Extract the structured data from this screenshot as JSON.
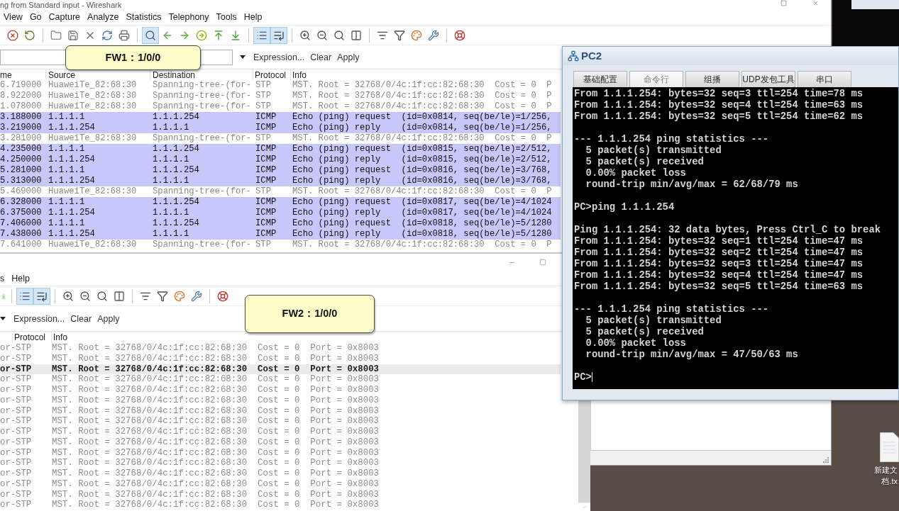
{
  "main_window": {
    "title": "ng from Standard input - Wireshark",
    "menu": [
      "View",
      "Go",
      "Capture",
      "Analyze",
      "Statistics",
      "Telephony",
      "Tools",
      "Help"
    ],
    "toolbar": [
      [
        {
          "pressed": false
        },
        {
          "pressed": false
        }
      ],
      [
        {
          "pressed": false
        },
        {
          "pressed": false
        },
        {
          "pressed": false
        },
        {
          "pressed": false
        },
        {
          "pressed": false
        }
      ],
      [
        {
          "pressed": true
        },
        {
          "pressed": false
        },
        {
          "pressed": false
        },
        {
          "pressed": false
        },
        {
          "pressed": false
        },
        {
          "pressed": false
        }
      ],
      [
        {
          "pressed": true
        },
        {
          "pressed": true
        }
      ],
      [
        {
          "pressed": false
        },
        {
          "pressed": false
        },
        {
          "pressed": false
        },
        {
          "pressed": false
        }
      ],
      [
        {
          "pressed": false
        },
        {
          "pressed": false
        },
        {
          "pressed": false
        },
        {
          "pressed": false
        }
      ],
      [
        {
          "pressed": false
        }
      ]
    ],
    "filter_buttons": [
      "Expression...",
      "Clear",
      "Apply"
    ],
    "packet_list": {
      "columns": [
        "me",
        "Source",
        "Destination",
        "Protocol",
        "Info"
      ],
      "rows": [
        {
          "kind": "stp",
          "time": "6.719000",
          "source": "HuaweiTe_82:68:30",
          "destination": "Spanning-tree-(for-",
          "protocol": "STP",
          "info": "MST. Root = 32768/0/4c:1f:cc:82:68:30  Cost = 0  P"
        },
        {
          "kind": "stp",
          "time": "8.922000",
          "source": "HuaweiTe_82:68:30",
          "destination": "Spanning-tree-(for-",
          "protocol": "STP",
          "info": "MST. Root = 32768/0/4c:1f:cc:82:68:30  Cost = 0  P"
        },
        {
          "kind": "stp",
          "time": "1.078000",
          "source": "HuaweiTe_82:68:30",
          "destination": "Spanning-tree-(for-",
          "protocol": "STP",
          "info": "MST. Root = 32768/0/4c:1f:cc:82:68:30  Cost = 0  P"
        },
        {
          "kind": "icmp",
          "time": "3.188000",
          "source": "1.1.1.1",
          "destination": "1.1.1.254",
          "protocol": "ICMP",
          "info": "Echo (ping) request  (id=0x0814, seq(be/le)=1/256,"
        },
        {
          "kind": "icmp",
          "time": "3.219000",
          "source": "1.1.1.254",
          "destination": "1.1.1.1",
          "protocol": "ICMP",
          "info": "Echo (ping) reply    (id=0x0814, seq(be/le)=1/256,"
        },
        {
          "kind": "stp",
          "time": "3.281000",
          "source": "HuaweiTe_82:68:30",
          "destination": "Spanning-tree-(for-",
          "protocol": "STP",
          "info": "MST. Root = 32768/0/4c:1f:cc:82:68:30  Cost = 0  P"
        },
        {
          "kind": "icmp",
          "time": "4.235000",
          "source": "1.1.1.1",
          "destination": "1.1.1.254",
          "protocol": "ICMP",
          "info": "Echo (ping) request  (id=0x0815, seq(be/le)=2/512,"
        },
        {
          "kind": "icmp",
          "time": "4.250000",
          "source": "1.1.1.254",
          "destination": "1.1.1.1",
          "protocol": "ICMP",
          "info": "Echo (ping) reply    (id=0x0815, seq(be/le)=2/512,"
        },
        {
          "kind": "icmp",
          "time": "5.281000",
          "source": "1.1.1.1",
          "destination": "1.1.1.254",
          "protocol": "ICMP",
          "info": "Echo (ping) request  (id=0x0816, seq(be/le)=3/768,"
        },
        {
          "kind": "icmp",
          "time": "5.313000",
          "source": "1.1.1.254",
          "destination": "1.1.1.1",
          "protocol": "ICMP",
          "info": "Echo (ping) reply    (id=0x0816, seq(be/le)=3/768,"
        },
        {
          "kind": "stp",
          "time": "5.469000",
          "source": "HuaweiTe_82:68:30",
          "destination": "Spanning-tree-(for-",
          "protocol": "STP",
          "info": "MST. Root = 32768/0/4c:1f:cc:82:68:30  Cost = 0  P"
        },
        {
          "kind": "icmp",
          "time": "6.328000",
          "source": "1.1.1.1",
          "destination": "1.1.1.254",
          "protocol": "ICMP",
          "info": "Echo (ping) request  (id=0x0817, seq(be/le)=4/1024"
        },
        {
          "kind": "icmp",
          "time": "6.375000",
          "source": "1.1.1.254",
          "destination": "1.1.1.1",
          "protocol": "ICMP",
          "info": "Echo (ping) reply    (id=0x0817, seq(be/le)=4/1024"
        },
        {
          "kind": "icmp",
          "time": "7.406000",
          "source": "1.1.1.1",
          "destination": "1.1.1.254",
          "protocol": "ICMP",
          "info": "Echo (ping) request  (id=0x0818, seq(be/le)=5/1280"
        },
        {
          "kind": "icmp",
          "time": "7.438000",
          "source": "1.1.1.254",
          "destination": "1.1.1.1",
          "protocol": "ICMP",
          "info": "Echo (ping) reply    (id=0x0818, seq(be/le)=5/1280"
        },
        {
          "kind": "stp",
          "time": "7.641000",
          "source": "HuaweiTe_82:68:30",
          "destination": "Spanning-tree-(for-",
          "protocol": "STP",
          "info": "MST. Root = 32768/0/4c:1f:cc:82:68:30  Cost = 0  P"
        }
      ]
    }
  },
  "second_window": {
    "menu": [
      "s",
      "Help"
    ],
    "toolbar": [
      [
        {
          "pressed": false
        }
      ],
      [
        {
          "pressed": true
        },
        {
          "pressed": true
        }
      ],
      [
        {
          "pressed": false
        },
        {
          "pressed": false
        },
        {
          "pressed": false
        },
        {
          "pressed": false
        }
      ],
      [
        {
          "pressed": false
        },
        {
          "pressed": false
        },
        {
          "pressed": false
        },
        {
          "pressed": false
        }
      ],
      [
        {
          "pressed": false
        }
      ]
    ],
    "filter_buttons": [
      "Expression...",
      "Clear",
      "Apply"
    ],
    "packet_list": {
      "columns": [
        "Protocol",
        "Info"
      ],
      "rows": [
        {
          "column_1": "or-",
          "protocol": "STP",
          "info": "MST. Root = 32768/0/4c:1f:cc:82:68:30  Cost = 0  Port = 0x8003",
          "selected": false
        },
        {
          "column_1": "or-",
          "protocol": "STP",
          "info": "MST. Root = 32768/0/4c:1f:cc:82:68:30  Cost = 0  Port = 0x8003",
          "selected": false
        },
        {
          "column_1": "or-",
          "protocol": "STP",
          "info": "MST. Root = 32768/0/4c:1f:cc:82:68:30  Cost = 0  Port = 0x8003",
          "selected": true
        },
        {
          "column_1": "or-",
          "protocol": "STP",
          "info": "MST. Root = 32768/0/4c:1f:cc:82:68:30  Cost = 0  Port = 0x8003",
          "selected": false
        },
        {
          "column_1": "or-",
          "protocol": "STP",
          "info": "MST. Root = 32768/0/4c:1f:cc:82:68:30  Cost = 0  Port = 0x8003",
          "selected": false
        },
        {
          "column_1": "or-",
          "protocol": "STP",
          "info": "MST. Root = 32768/0/4c:1f:cc:82:68:30  Cost = 0  Port = 0x8003",
          "selected": false
        },
        {
          "column_1": "or-",
          "protocol": "STP",
          "info": "MST. Root = 32768/0/4c:1f:cc:82:68:30  Cost = 0  Port = 0x8003",
          "selected": false
        },
        {
          "column_1": "or-",
          "protocol": "STP",
          "info": "MST. Root = 32768/0/4c:1f:cc:82:68:30  Cost = 0  Port = 0x8003",
          "selected": false
        },
        {
          "column_1": "or-",
          "protocol": "STP",
          "info": "MST. Root = 32768/0/4c:1f:cc:82:68:30  Cost = 0  Port = 0x8003",
          "selected": false
        },
        {
          "column_1": "or-",
          "protocol": "STP",
          "info": "MST. Root = 32768/0/4c:1f:cc:82:68:30  Cost = 0  Port = 0x8003",
          "selected": false
        },
        {
          "column_1": "or-",
          "protocol": "STP",
          "info": "MST. Root = 32768/0/4c:1f:cc:82:68:30  Cost = 0  Port = 0x8003",
          "selected": false
        },
        {
          "column_1": "or-",
          "protocol": "STP",
          "info": "MST. Root = 32768/0/4c:1f:cc:82:68:30  Cost = 0  Port = 0x8003",
          "selected": false
        },
        {
          "column_1": "or-",
          "protocol": "STP",
          "info": "MST. Root = 32768/0/4c:1f:cc:82:68:30  Cost = 0  Port = 0x8003",
          "selected": false
        },
        {
          "column_1": "or-",
          "protocol": "STP",
          "info": "MST. Root = 32768/0/4c:1f:cc:82:68:30  Cost = 0  Port = 0x8003",
          "selected": false
        },
        {
          "column_1": "or-",
          "protocol": "STP",
          "info": "MST. Root = 32768/0/4c:1f:cc:82:68:30  Cost = 0  Port = 0x8003",
          "selected": false
        },
        {
          "column_1": "or-",
          "protocol": "STP",
          "info": "MST. Root = 32768/0/4c:1f:cc:82:68:30  Cost = 0  Port = 0x8003",
          "selected": false
        }
      ]
    }
  },
  "pc2_window": {
    "title": "PC2",
    "tabs": [
      {
        "label": "基础配置",
        "selected": false
      },
      {
        "label": "命令行",
        "selected": true
      },
      {
        "label": "组播",
        "selected": false
      },
      {
        "label": "UDP发包工具",
        "selected": false
      },
      {
        "label": "串口",
        "selected": false
      }
    ],
    "terminal": [
      [
        "From 1.1.1.254: bytes=32 seq=3 ttl=254 time=78 ms",
        "From 1.1.1.254: bytes=32 seq=4 ttl=254 time=63 ms",
        "From 1.1.1.254: bytes=32 seq=5 ttl=254 time=62 ms"
      ],
      [
        "--- 1.1.1.254 ping statistics ---",
        "  5 packet(s) transmitted",
        "  5 packet(s) received",
        "  0.00% packet loss",
        "  round-trip min/avg/max = 62/68/79 ms"
      ],
      [
        "PC>ping 1.1.1.254"
      ],
      [
        "Ping 1.1.1.254: 32 data bytes, Press Ctrl_C to break",
        "From 1.1.1.254: bytes=32 seq=1 ttl=254 time=47 ms",
        "From 1.1.1.254: bytes=32 seq=2 ttl=254 time=47 ms",
        "From 1.1.1.254: bytes=32 seq=3 ttl=254 time=47 ms",
        "From 1.1.1.254: bytes=32 seq=4 ttl=254 time=47 ms",
        "From 1.1.1.254: bytes=32 seq=5 ttl=254 time=63 ms"
      ],
      [
        "--- 1.1.1.254 ping statistics ---",
        "  5 packet(s) transmitted",
        "  5 packet(s) received",
        "  0.00% packet loss",
        "  round-trip min/avg/max = 47/50/63 ms"
      ],
      [
        "PC>"
      ]
    ]
  },
  "callouts": [
    "FW1：1/0/0",
    "FW2：1/0/0"
  ],
  "desktop_icon": {
    "label_lines": [
      "新建文",
      "档.tx"
    ]
  }
}
